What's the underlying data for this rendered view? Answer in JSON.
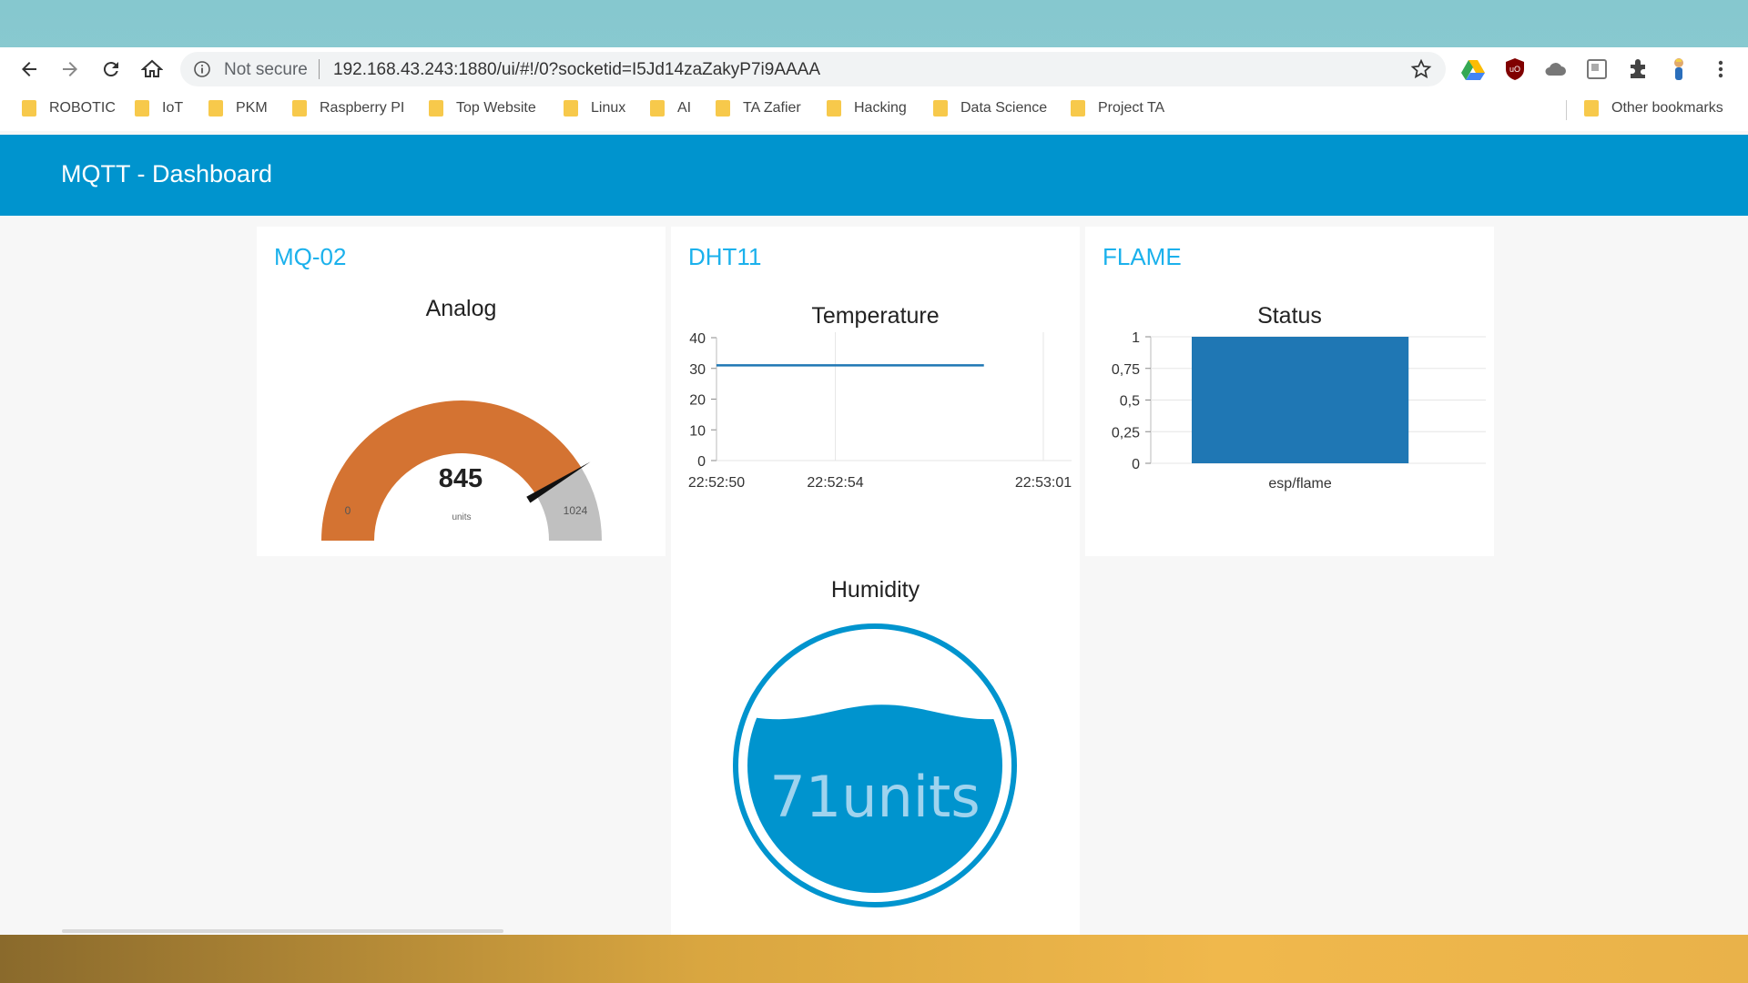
{
  "browser": {
    "secure_label": "Not secure",
    "url": "192.168.43.243:1880/ui/#!/0?socketid=I5Jd14zaZakyP7i9AAAA",
    "bookmarks": [
      "ROBOTIC",
      "IoT",
      "PKM",
      "Raspberry PI",
      "Top Website",
      "Linux",
      "AI",
      "TA Zafier",
      "Hacking",
      "Data Science",
      "Project TA"
    ],
    "other_bookmarks": "Other bookmarks"
  },
  "dashboard": {
    "title": "MQTT - Dashboard",
    "groups": {
      "mq02": {
        "title": "MQ-02"
      },
      "dht11": {
        "title": "DHT11"
      },
      "flame": {
        "title": "FLAME"
      }
    }
  },
  "gauge": {
    "title": "Analog",
    "value": "845",
    "units": "units",
    "min": "0",
    "max": "1024",
    "min_value": 0,
    "max_value": 1024,
    "current": 845,
    "colors": {
      "fill": "#d47332",
      "track": "#c0c0c0",
      "needle": "#111111"
    }
  },
  "temperature_chart": {
    "title": "Temperature",
    "chart_data": {
      "type": "line",
      "title": "Temperature",
      "x_ticks": [
        "22:52:50",
        "22:52:54",
        "22:53:01"
      ],
      "y_ticks": [
        "40",
        "30",
        "20",
        "10",
        "0"
      ],
      "ylim": [
        0,
        40
      ],
      "series": [
        {
          "x": [
            "22:52:50",
            "22:52:59"
          ],
          "values": [
            31,
            31
          ]
        }
      ],
      "color": "#1f77b4",
      "grid": true
    }
  },
  "status_chart": {
    "title": "Status",
    "chart_data": {
      "type": "bar",
      "title": "Status",
      "categories": [
        "esp/flame"
      ],
      "values": [
        1
      ],
      "y_ticks": [
        "1",
        "0,75",
        "0,5",
        "0,25",
        "0"
      ],
      "ylim": [
        0,
        1
      ],
      "color": "#1f77b4",
      "grid": true
    }
  },
  "humidity": {
    "title": "Humidity",
    "display": "71units",
    "value": 71,
    "colors": {
      "liquid": "#0094ce",
      "ring": "#0094ce",
      "text": "#9fd3ee"
    }
  }
}
